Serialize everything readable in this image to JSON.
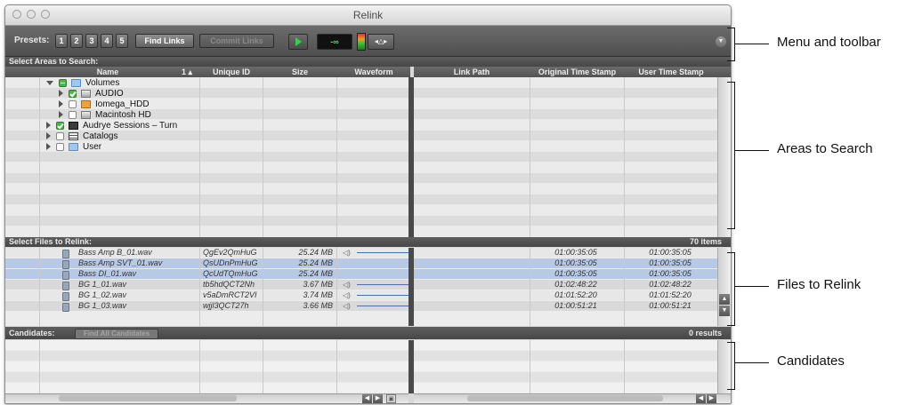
{
  "window": {
    "title": "Relink"
  },
  "toolbar": {
    "presets_label": "Presets:",
    "presets": [
      "1",
      "2",
      "3",
      "4",
      "5"
    ],
    "find_links_label": "Find Links",
    "commit_links_label": "Commit Links",
    "meter_value": "-∞",
    "nudge_label": "◂△▸"
  },
  "areas": {
    "header": "Select Areas to Search:",
    "columns": {
      "name": "Name",
      "sort_indicator": "1 ▴",
      "unique_id": "Unique ID",
      "size": "Size",
      "waveform": "Waveform",
      "link_path": "Link Path",
      "original_time_stamp": "Original Time Stamp",
      "user_time_stamp": "User Time Stamp"
    },
    "tree": [
      {
        "label": "Volumes",
        "depth": 0,
        "expanded": true,
        "check": "mixed",
        "icon": "folder-icon"
      },
      {
        "label": "AUDIO",
        "depth": 1,
        "expanded": false,
        "check": "on",
        "icon": "disk-icon"
      },
      {
        "label": "Iomega_HDD",
        "depth": 1,
        "expanded": false,
        "check": "off",
        "icon": "hard-drive-icon"
      },
      {
        "label": "Macintosh HD",
        "depth": 1,
        "expanded": false,
        "check": "off",
        "icon": "disk-icon"
      },
      {
        "label": "Audrye Sessions – Turn",
        "depth": 0,
        "expanded": false,
        "check": "on",
        "icon": "session-icon"
      },
      {
        "label": "Catalogs",
        "depth": 0,
        "expanded": false,
        "check": "off",
        "icon": "catalog-icon"
      },
      {
        "label": "User",
        "depth": 0,
        "expanded": false,
        "check": "off",
        "icon": "folder-icon"
      }
    ]
  },
  "files": {
    "header": "Select Files to Relink:",
    "count": "70 items",
    "rows": [
      {
        "name": "Bass Amp B_01.wav",
        "unique_id": "QgEv2QmHuG",
        "size": "25.24 MB",
        "waveform": true,
        "original_ts": "01:00:35:05",
        "user_ts": "01:00:35:05",
        "selected": false
      },
      {
        "name": "Bass Amp SVT_01.wav",
        "unique_id": "QsUDnPmHuG",
        "size": "25.24 MB",
        "waveform": false,
        "original_ts": "01:00:35:05",
        "user_ts": "01:00:35:05",
        "selected": true
      },
      {
        "name": "Bass DI_01.wav",
        "unique_id": "QcUdTQmHuG",
        "size": "25.24 MB",
        "waveform": false,
        "original_ts": "01:00:35:05",
        "user_ts": "01:00:35:05",
        "selected": true
      },
      {
        "name": "BG 1_01.wav",
        "unique_id": "tb5hdQCT2Nh",
        "size": "3.67 MB",
        "waveform": true,
        "original_ts": "01:02:48:22",
        "user_ts": "01:02:48:22",
        "selected": false
      },
      {
        "name": "BG 1_02.wav",
        "unique_id": "v5aDmRCT2VI",
        "size": "3.74 MB",
        "waveform": true,
        "original_ts": "01:01:52:20",
        "user_ts": "01:01:52:20",
        "selected": false
      },
      {
        "name": "BG 1_03.wav",
        "unique_id": "wjjl3QCT27h",
        "size": "3.66 MB",
        "waveform": true,
        "original_ts": "01:00:51:21",
        "user_ts": "01:00:51:21",
        "selected": false
      }
    ]
  },
  "candidates": {
    "header": "Candidates:",
    "find_all_label": "Find All Candidates",
    "count": "0 results"
  },
  "callouts": {
    "menu_toolbar": "Menu and toolbar",
    "areas_to_search": "Areas to Search",
    "files_to_relink": "Files to Relink",
    "candidates": "Candidates"
  },
  "colors": {
    "selected_row": "#b8c9e6",
    "accent_green": "#49b749",
    "toolbar_dark": "#4f4f4f"
  }
}
